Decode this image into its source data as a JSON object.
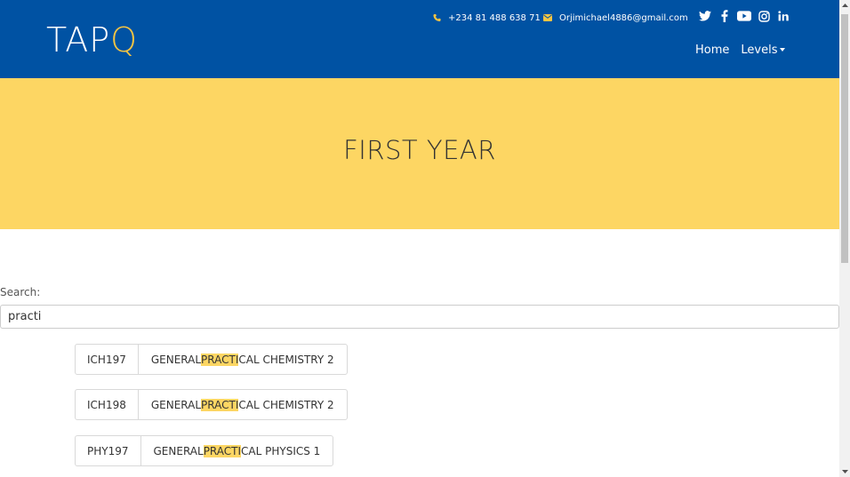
{
  "header": {
    "logo_prefix": "TAP",
    "logo_suffix": "Q",
    "phone": "+234 81 488 638 71",
    "email": "Orjimichael4886@gmail.com",
    "social_icons": [
      "twitter-icon",
      "facebook-icon",
      "youtube-icon",
      "instagram-icon",
      "linkedin-icon"
    ],
    "nav": {
      "home_label": "Home",
      "levels_label": "Levels"
    }
  },
  "hero": {
    "title": "FIRST YEAR"
  },
  "search": {
    "label": "Search:",
    "value": "practi"
  },
  "results": [
    {
      "code": "ICH197",
      "pre": "GENERAL ",
      "match": "PRACTI",
      "post": "CAL CHEMISTRY 2"
    },
    {
      "code": "ICH198",
      "pre": "GENERAL ",
      "match": "PRACTI",
      "post": "CAL CHEMISTRY 2"
    },
    {
      "code": "PHY197",
      "pre": "GENERAL ",
      "match": "PRACTI",
      "post": "CAL PHYSICS 1"
    }
  ],
  "colors": {
    "header_bg": "#0052a3",
    "hero_bg": "#fdd663",
    "accent": "#f5c542",
    "highlight": "#fdd663"
  }
}
